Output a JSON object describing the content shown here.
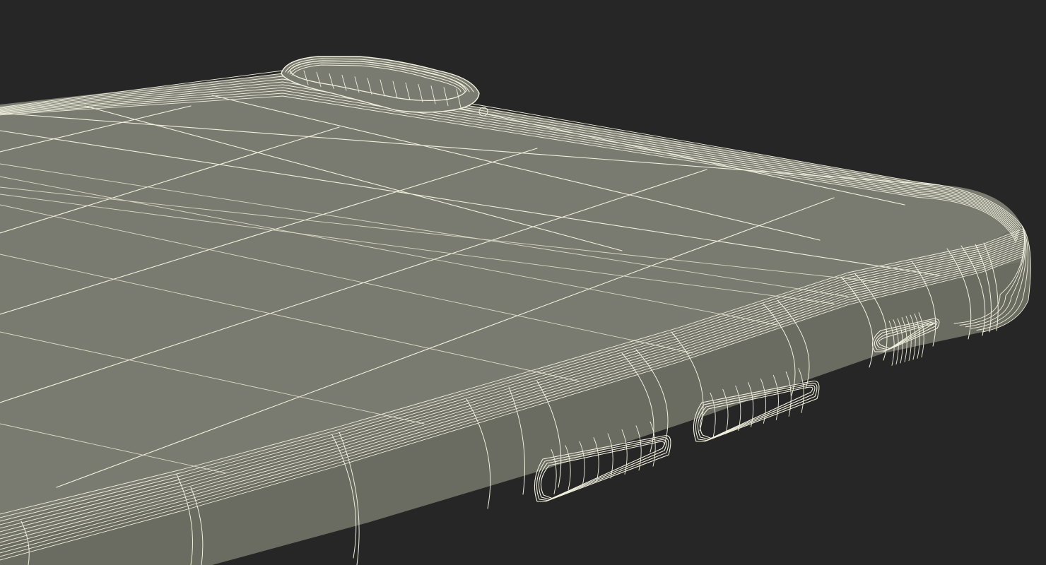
{
  "scene": {
    "subject": "phone-wireframe-render",
    "colors": {
      "background": "#262626",
      "surface_top": "#7a7b70",
      "surface_side": "#727368",
      "surface_side_dark": "#6a6b61",
      "wire": "#f1f1df",
      "wire_dim": "#d9d9c5"
    }
  }
}
